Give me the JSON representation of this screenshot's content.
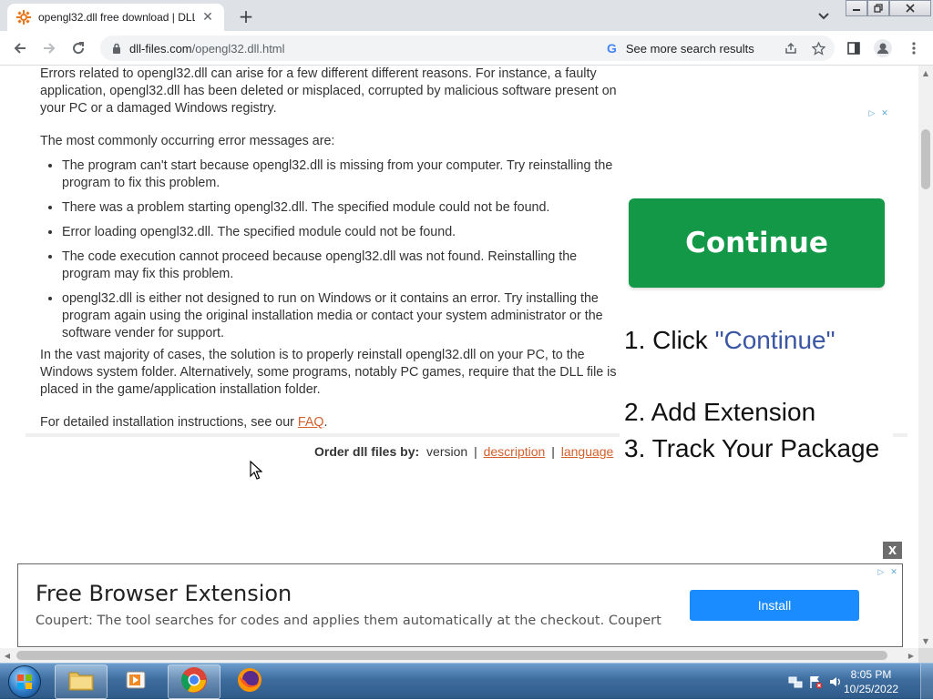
{
  "browser": {
    "tab_title": "opengl32.dll free download | DLL",
    "tab_close": "✕",
    "new_tab": "+",
    "url_domain": "dll-files.com",
    "url_path": "/opengl32.dll.html",
    "search_chip": "See more search results"
  },
  "article": {
    "intro": "Errors related to opengl32.dll can arise for a few different different reasons. For instance, a faulty application, opengl32.dll has been deleted or misplaced, corrupted by malicious software present on your PC or a damaged Windows registry.",
    "errors_heading": "The most commonly occurring error messages are:",
    "errors": [
      "The program can't start because opengl32.dll is missing from your computer. Try reinstalling the program to fix this problem.",
      "There was a problem starting opengl32.dll. The specified module could not be found.",
      "Error loading opengl32.dll. The specified module could not be found.",
      "The code execution cannot proceed because opengl32.dll was not found. Reinstalling the program may fix this problem.",
      "opengl32.dll is either not designed to run on Windows or it contains an error. Try installing the program again using the original installation media or contact your system administrator or the software vender for support."
    ],
    "solution": "In the vast majority of cases, the solution is to properly reinstall opengl32.dll on your PC, to the Windows system folder. Alternatively, some programs, notably PC games, require that the DLL file is placed in the game/application installation folder.",
    "faq_prefix": "For detailed installation instructions, see our ",
    "faq_link": "FAQ",
    "faq_suffix": "."
  },
  "order_by": {
    "label": "Order dll files by:",
    "version": "version",
    "sep": "|",
    "description": "description",
    "language": "language"
  },
  "side_ad": {
    "button": "Continue",
    "step1_prefix": "1. Click ",
    "step1_quote": "\"Continue\"",
    "step2": "2. Add Extension",
    "step3": "3. Track Your Package"
  },
  "bottom_ad": {
    "close": "X",
    "title": "Free Browser Extension",
    "description": "Coupert: The tool searches for codes and applies them automatically at the checkout. Coupert",
    "install": "Install"
  },
  "taskbar": {
    "time": "8:05 PM",
    "date": "10/25/2022"
  },
  "colors": {
    "continue_green": "#139847",
    "link_orange": "#d35f2b",
    "install_blue": "#1a8cff"
  }
}
